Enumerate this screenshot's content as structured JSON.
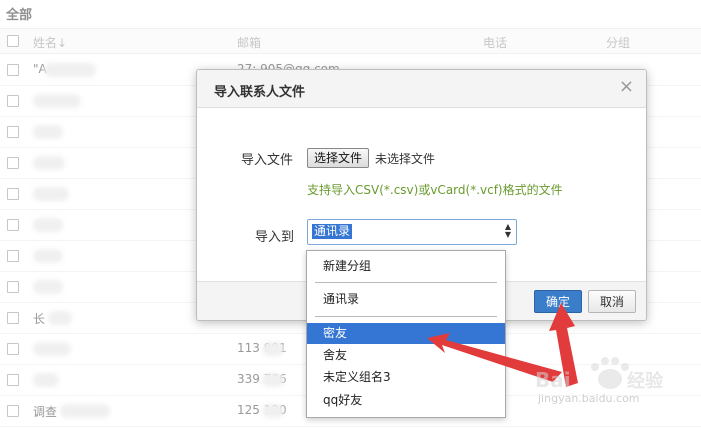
{
  "page": {
    "heading": "全部"
  },
  "list": {
    "columns": {
      "name": "姓名↓",
      "email": "邮箱",
      "phone": "电话",
      "group": "分组"
    },
    "rows": [
      {
        "name": "\"A",
        "email": "27:    905@qq.com"
      },
      {
        "name": "",
        "email": ""
      },
      {
        "name": "",
        "email": ""
      },
      {
        "name": "",
        "email": ""
      },
      {
        "name": "",
        "email": ""
      },
      {
        "name": "",
        "email": ""
      },
      {
        "name": "",
        "email": ""
      },
      {
        "name": "",
        "email": ""
      },
      {
        "name": "长",
        "email": ""
      },
      {
        "name": "",
        "email": "113    991"
      },
      {
        "name": "",
        "email": "339    706"
      },
      {
        "name": "调查",
        "email": "125    120"
      }
    ]
  },
  "modal": {
    "title": "导入联系人文件",
    "close_icon": "×",
    "file_label": "导入文件",
    "file_button": "选择文件",
    "file_status": "未选择文件",
    "hint": "支持导入CSV(*.csv)或vCard(*.vcf)格式的文件",
    "target_label": "导入到",
    "target_value": "通讯录",
    "ok": "确定",
    "cancel": "取消"
  },
  "dropdown": {
    "options": [
      "新建分组",
      "通讯录",
      "密友",
      "舍友",
      "未定义组名3",
      "qq好友"
    ],
    "selected": "密友"
  },
  "annotation": {
    "arrow_color": "#e23b3b"
  },
  "watermark": {
    "text": "jingyan.baidu.com"
  }
}
